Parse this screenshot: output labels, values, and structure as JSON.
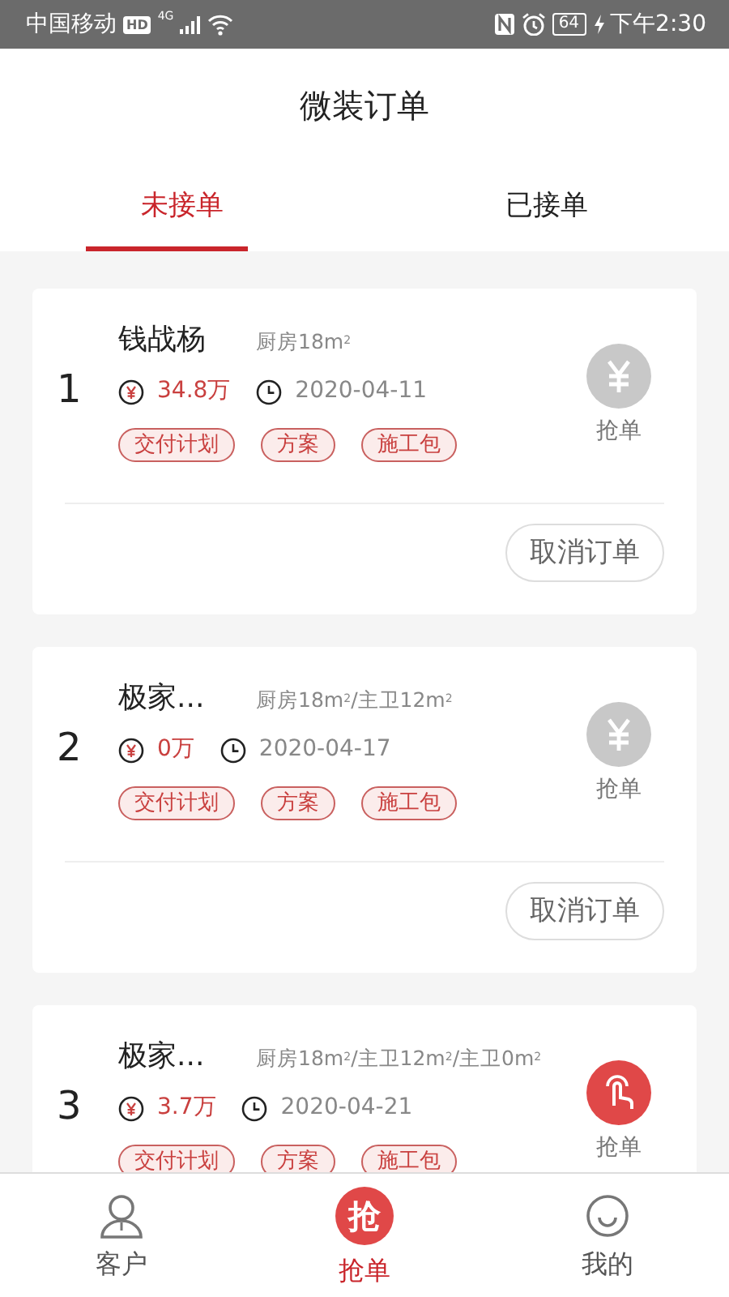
{
  "status_bar": {
    "carrier": "中国移动",
    "hd": "HD",
    "network": "4G",
    "battery": "64",
    "time": "下午2:30"
  },
  "title": "微装订单",
  "tabs": [
    {
      "label": "未接单",
      "selected": true
    },
    {
      "label": "已接单",
      "selected": false
    }
  ],
  "orders": [
    {
      "index": "1",
      "name": "钱战杨",
      "area": "厨房18m$^{2}$",
      "price": "34.8万",
      "date": "2020-04-11",
      "tags": [
        "交付计划",
        "方案",
        "施工包"
      ],
      "grab_enabled": false,
      "grab_label": "抢单",
      "cancel_button": "取消订单"
    },
    {
      "index": "2",
      "name": "极家...",
      "area": "厨房18m$^{2}$/主卫12m$^{2}$",
      "price": "0万",
      "date": "2020-04-17",
      "tags": [
        "交付计划",
        "方案",
        "施工包"
      ],
      "grab_enabled": false,
      "grab_label": "抢单",
      "cancel_button": "取消订单"
    },
    {
      "index": "3",
      "name": "极家...",
      "area": "厨房18m$^{2}$/主卫12m$^{2}$/主卫0m$^{2}$",
      "price": "3.7万",
      "date": "2020-04-21",
      "tags": [
        "交付计划",
        "方案",
        "施工包"
      ],
      "grab_enabled": true,
      "grab_label": "抢单"
    }
  ],
  "bottom_nav": [
    {
      "kind": "person",
      "label": "客户",
      "selected": false
    },
    {
      "kind": "grab",
      "badge": "抢",
      "label": "抢单",
      "selected": true
    },
    {
      "kind": "smile",
      "label": "我的",
      "selected": false
    }
  ]
}
